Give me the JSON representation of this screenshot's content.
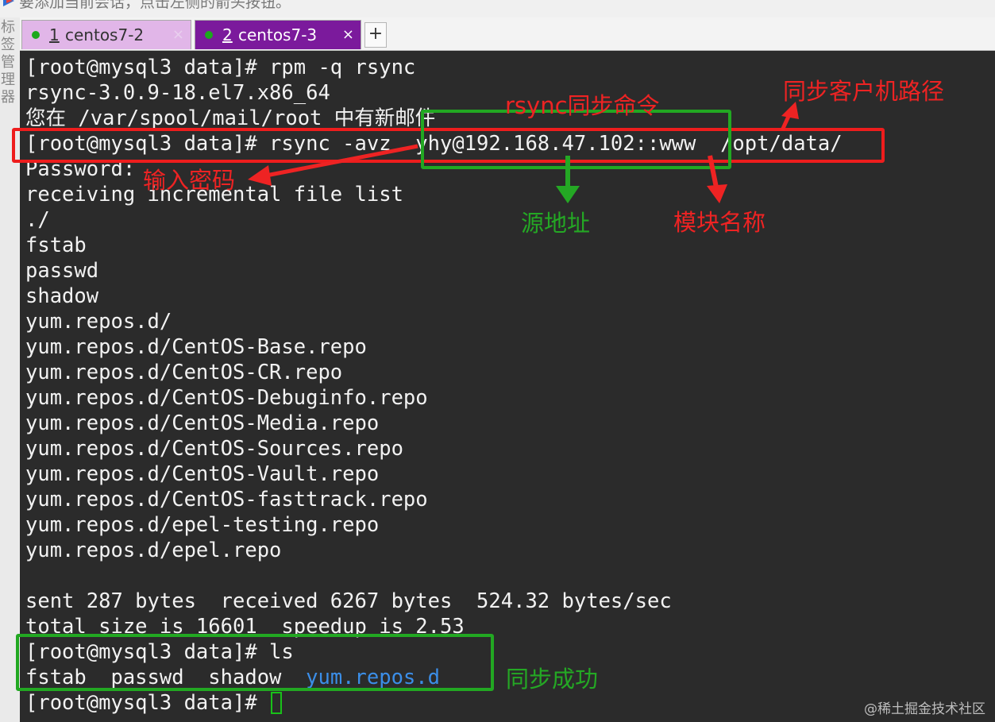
{
  "top_notice": "要添加当前会话，点击左侧的箭头按钮。",
  "sidebar_label": "标签管理器",
  "tabs": [
    {
      "number": "1",
      "name": "centos7-2",
      "close": "×",
      "status_color": "#1ca81c"
    },
    {
      "number": "2",
      "name": "centos7-3",
      "close": "×",
      "status_color": "#1ca81c"
    }
  ],
  "add_tab_label": "+",
  "terminal": {
    "lines": [
      "[root@mysql3 data]# rpm -q rsync",
      "rsync-3.0.9-18.el7.x86_64",
      "您在 /var/spool/mail/root 中有新邮件",
      "[root@mysql3 data]# rsync -avz  yhy@192.168.47.102::www  /opt/data/",
      "Password:",
      "receiving incremental file list",
      "./",
      "fstab",
      "passwd",
      "shadow",
      "yum.repos.d/",
      "yum.repos.d/CentOS-Base.repo",
      "yum.repos.d/CentOS-CR.repo",
      "yum.repos.d/CentOS-Debuginfo.repo",
      "yum.repos.d/CentOS-Media.repo",
      "yum.repos.d/CentOS-Sources.repo",
      "yum.repos.d/CentOS-Vault.repo",
      "yum.repos.d/CentOS-fasttrack.repo",
      "yum.repos.d/epel-testing.repo",
      "yum.repos.d/epel.repo",
      "",
      "sent 287 bytes  received 6267 bytes  524.32 bytes/sec",
      "total size is 16601  speedup is 2.53",
      "[root@mysql3 data]# ls"
    ],
    "ls_output_plain": "fstab  passwd  shadow  ",
    "ls_output_dir": "yum.repos.d",
    "final_prompt": "[root@mysql3 data]# ",
    "dir_color": "#3b8ee8"
  },
  "annotations": {
    "rsync_command": "rsync同步命令",
    "client_path": "同步客户机路径",
    "enter_password": "输入密码",
    "source_address": "源地址",
    "module_name": "模块名称",
    "sync_success": "同步成功",
    "red_color": "#ee2323",
    "green_color": "#24a824"
  },
  "watermark": "@稀土掘金技术社区"
}
